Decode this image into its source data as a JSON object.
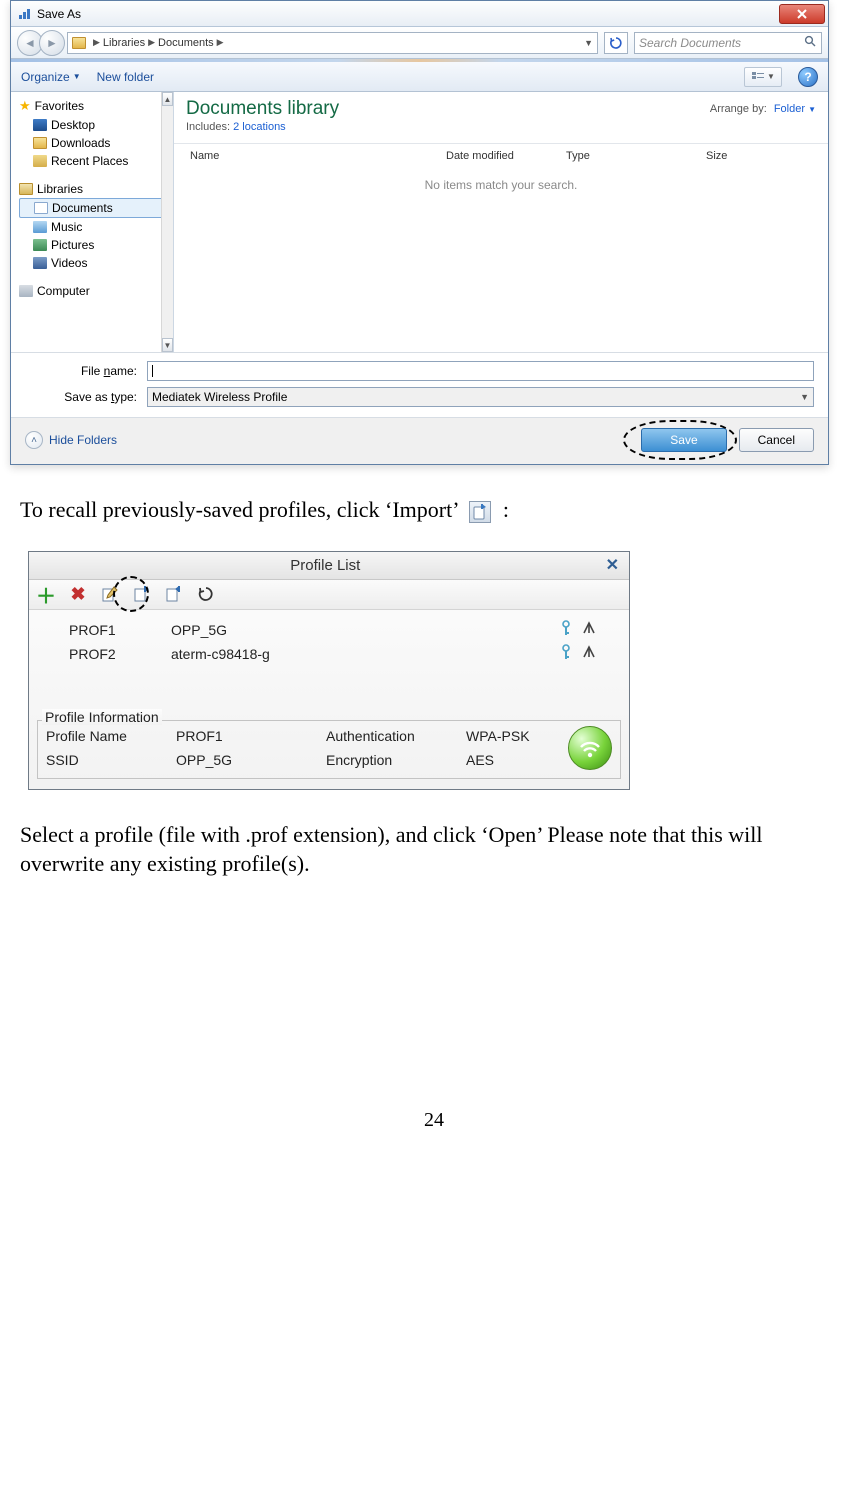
{
  "saveas": {
    "title": "Save As",
    "breadcrumb": [
      "Libraries",
      "Documents"
    ],
    "search_placeholder": "Search Documents",
    "cmdbar": {
      "organize": "Organize",
      "newfolder": "New folder"
    },
    "tree": {
      "favorites": {
        "label": "Favorites",
        "items": [
          "Desktop",
          "Downloads",
          "Recent Places"
        ]
      },
      "libraries": {
        "label": "Libraries",
        "items": [
          "Documents",
          "Music",
          "Pictures",
          "Videos"
        ]
      },
      "computer": {
        "label": "Computer"
      }
    },
    "library": {
      "title": "Documents library",
      "includes_label": "Includes:",
      "includes_link": "2 locations",
      "arrange_label": "Arrange by:",
      "arrange_value": "Folder"
    },
    "columns": {
      "name": "Name",
      "date": "Date modified",
      "type": "Type",
      "size": "Size"
    },
    "empty": "No items match your search.",
    "fields": {
      "name_label_pre": "File ",
      "name_label_u": "n",
      "name_label_post": "ame:",
      "type_label_pre": "Save as ",
      "type_label_u": "t",
      "type_label_post": "ype:",
      "type_value": "Mediatek Wireless Profile"
    },
    "footer": {
      "hide": "Hide Folders",
      "save": "Save",
      "cancel": "Cancel"
    }
  },
  "para1_pre": "To recall previously-saved profiles, click ‘Import’ ",
  "para1_post": " :",
  "profile": {
    "title": "Profile List",
    "rows": [
      {
        "name": "PROF1",
        "ssid": "OPP_5G"
      },
      {
        "name": "PROF2",
        "ssid": "aterm-c98418-g"
      }
    ],
    "info": {
      "legend": "Profile Information",
      "pname_l": "Profile Name",
      "pname_v": "PROF1",
      "auth_l": "Authentication",
      "auth_v": "WPA-PSK",
      "ssid_l": "SSID",
      "ssid_v": "OPP_5G",
      "enc_l": "Encryption",
      "enc_v": "AES"
    }
  },
  "para2": "Select a profile (file with .prof extension), and click ‘Open’ Please note that this will overwrite any existing profile(s).",
  "page_number": "24"
}
